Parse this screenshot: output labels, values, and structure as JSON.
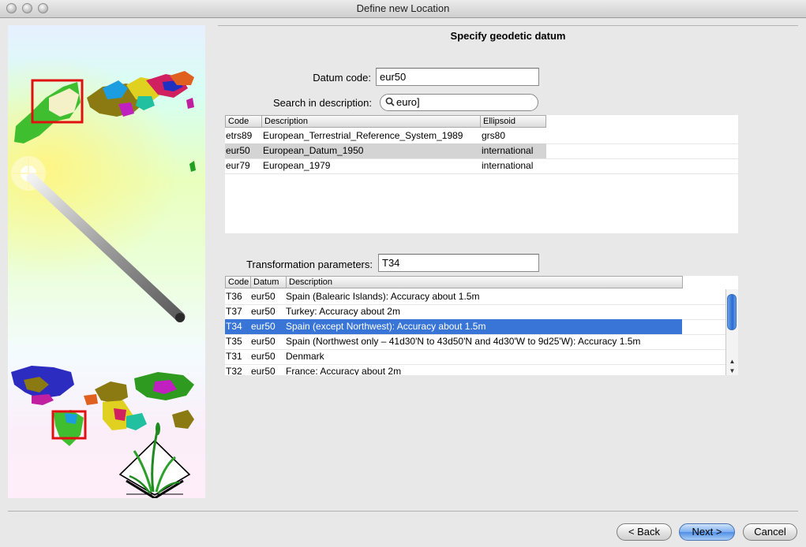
{
  "window": {
    "title": "Define new Location"
  },
  "page": {
    "section_title": "Specify geodetic datum"
  },
  "datum_code": {
    "label": "Datum code:",
    "value": "eur50"
  },
  "search": {
    "label": "Search in description:",
    "value": "euro]"
  },
  "datum_table": {
    "columns": [
      "Code",
      "Description",
      "Ellipsoid"
    ],
    "rows": [
      {
        "code": "etrs89",
        "description": "European_Terrestrial_Reference_System_1989",
        "ellipsoid": "grs80",
        "selected": false
      },
      {
        "code": "eur50",
        "description": "European_Datum_1950",
        "ellipsoid": "international",
        "selected": true
      },
      {
        "code": "eur79",
        "description": "European_1979",
        "ellipsoid": "international",
        "selected": false
      }
    ]
  },
  "transform": {
    "label": "Transformation parameters:",
    "value": "T34"
  },
  "transform_table": {
    "columns": [
      "Code",
      "Datum",
      "Description"
    ],
    "rows": [
      {
        "code": "T36",
        "datum": "eur50",
        "description": "Spain (Balearic Islands): Accuracy about 1.5m",
        "selected": false
      },
      {
        "code": "T37",
        "datum": "eur50",
        "description": "Turkey: Accuracy about 2m",
        "selected": false
      },
      {
        "code": "T34",
        "datum": "eur50",
        "description": "Spain (except Northwest): Accuracy about 1.5m",
        "selected": true
      },
      {
        "code": "T35",
        "datum": "eur50",
        "description": "Spain (Northwest only – 41d30'N to 43d50'N and 4d30'W to 9d25'W): Accuracy 1.5m",
        "selected": false
      },
      {
        "code": "T31",
        "datum": "eur50",
        "description": "Denmark",
        "selected": false
      },
      {
        "code": "T32",
        "datum": "eur50",
        "description": "France: Accuracy about 2m",
        "selected": false
      }
    ]
  },
  "buttons": {
    "back": "< Back",
    "next": "Next >",
    "cancel": "Cancel"
  },
  "colors": {
    "selection_blue": "#3875d7",
    "selection_grey": "#d4d4d4",
    "highlight_red": "#e01010"
  },
  "icons": {
    "search": "magnifier-icon",
    "side_art": "grass-logo"
  }
}
